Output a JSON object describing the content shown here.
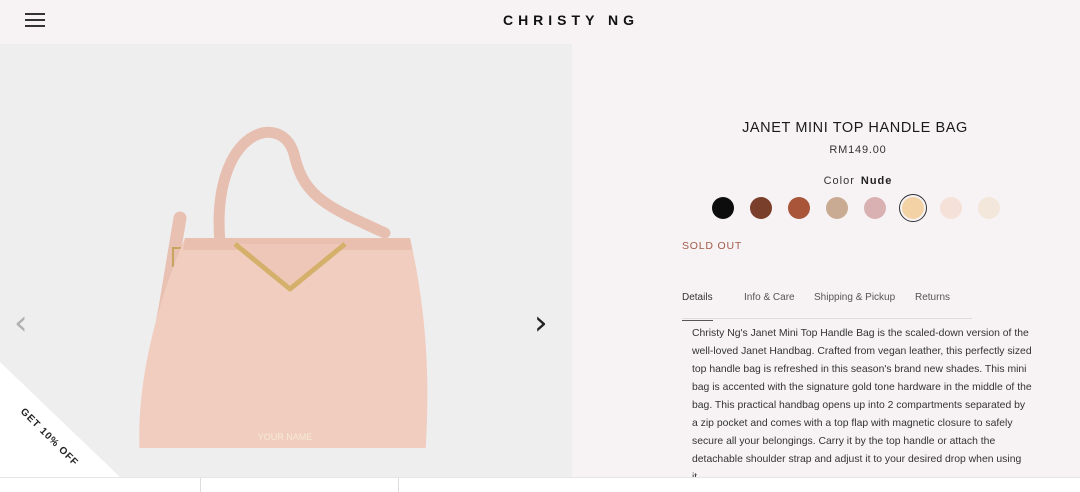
{
  "header": {
    "brand": "CHRISTY NG"
  },
  "gallery": {
    "watermark": "YOUR NAME",
    "promo": "GET 10% OFF"
  },
  "product": {
    "title": "JANET MINI TOP HANDLE BAG",
    "price": "RM149.00",
    "color_label": "Color",
    "color_value": "Nude",
    "swatches": [
      "#0d0d0d",
      "#7a3f2b",
      "#a8553a",
      "#c9ab93",
      "#d9b1b2",
      "#f3d2a6",
      "#f6e1d9",
      "#f3e6da"
    ],
    "selected_swatch": 5,
    "status": "SOLD OUT"
  },
  "tabs": [
    "Details",
    "Info & Care",
    "Shipping & Pickup",
    "Returns"
  ],
  "description": "Christy Ng's Janet Mini Top Handle Bag is the scaled-down version of the well-loved Janet Handbag. Crafted from vegan leather, this perfectly sized top handle bag is refreshed in this season's brand new shades. This mini bag is accented with the signature gold tone hardware in the middle of the bag. This practical handbag opens up into 2 compartments separated by a zip pocket and comes with a top flap with magnetic closure to safely secure all your belongings. Carry it by the top handle or attach the detachable shoulder strap and adjust it to your desired drop when using it."
}
